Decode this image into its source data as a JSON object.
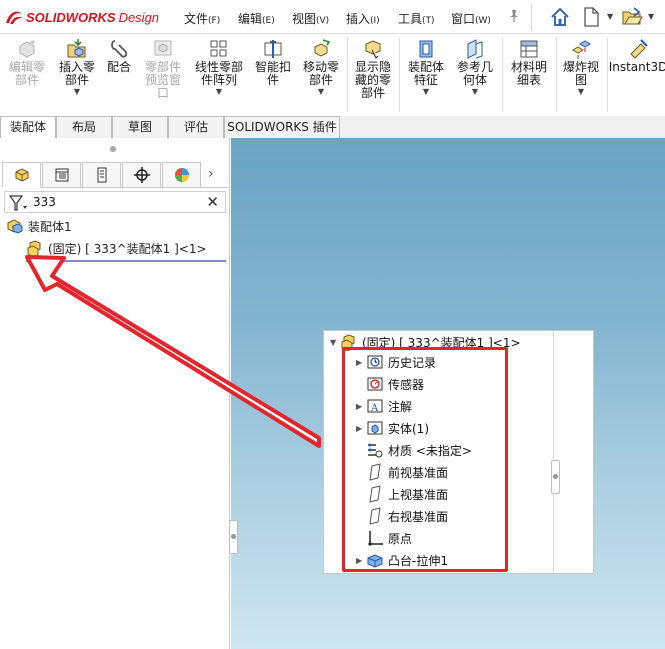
{
  "app": {
    "brand": "SOLIDWORKS",
    "brand_suffix": "Design",
    "brand_color": "#d0161f"
  },
  "menu": [
    {
      "label": "文件",
      "key": "(F)"
    },
    {
      "label": "编辑",
      "key": "(E)"
    },
    {
      "label": "视图",
      "key": "(V)"
    },
    {
      "label": "插入",
      "key": "(I)"
    },
    {
      "label": "工具",
      "key": "(T)"
    },
    {
      "label": "窗口",
      "key": "(W)"
    }
  ],
  "toolbar_icons": [
    "pin-icon",
    "home-icon",
    "new-document-icon",
    "open-folder-icon"
  ],
  "ribbon": [
    {
      "label": "编辑零\n部件",
      "icon": "edit-component-icon",
      "enabled": false,
      "dropdown": false
    },
    {
      "label": "插入零\n部件",
      "icon": "insert-component-icon",
      "enabled": true,
      "dropdown": true
    },
    {
      "label": "配合",
      "icon": "mate-icon",
      "enabled": true,
      "dropdown": false
    },
    {
      "label": "零部件\n预览窗\n口",
      "icon": "component-preview-icon",
      "enabled": false,
      "dropdown": false
    },
    {
      "label": "线性零部\n件阵列",
      "icon": "linear-pattern-icon",
      "enabled": true,
      "dropdown": true
    },
    {
      "label": "智能扣\n件",
      "icon": "smart-fastener-icon",
      "enabled": true,
      "dropdown": false
    },
    {
      "label": "移动零\n部件",
      "icon": "move-component-icon",
      "enabled": true,
      "dropdown": true
    },
    {
      "label": "显示隐\n藏的零\n部件",
      "icon": "show-hidden-icon",
      "enabled": true,
      "dropdown": false
    },
    {
      "label": "装配体\n特征",
      "icon": "assembly-feature-icon",
      "enabled": true,
      "dropdown": true
    },
    {
      "label": "参考几\n何体",
      "icon": "reference-geometry-icon",
      "enabled": true,
      "dropdown": true
    },
    {
      "label": "材料明\n细表",
      "icon": "bom-icon",
      "enabled": true,
      "dropdown": false
    },
    {
      "label": "爆炸视\n图",
      "icon": "exploded-view-icon",
      "enabled": true,
      "dropdown": true
    },
    {
      "label": "Instant3D",
      "icon": "instant3d-icon",
      "enabled": true,
      "dropdown": false
    }
  ],
  "command_tabs": [
    {
      "label": "装配体",
      "active": true
    },
    {
      "label": "布局",
      "active": false
    },
    {
      "label": "草图",
      "active": false
    },
    {
      "label": "评估",
      "active": false
    },
    {
      "label": "SOLIDWORKS 插件",
      "active": false
    }
  ],
  "panel": {
    "tabs": [
      "feature-manager-icon",
      "property-manager-icon",
      "configuration-manager-icon",
      "dimxpert-icon",
      "display-manager-icon"
    ],
    "filter_value": "333",
    "tree": {
      "root": "装配体1",
      "child": "(固定) [ 333^装配体1 ]<1>"
    }
  },
  "popup": {
    "title": "(固定) [ 333^装配体1 ]<1>",
    "items": [
      {
        "label": "历史记录",
        "icon": "history-folder-icon",
        "expandable": true
      },
      {
        "label": "传感器",
        "icon": "sensor-icon",
        "expandable": false
      },
      {
        "label": "注解",
        "icon": "annotation-icon",
        "expandable": true
      },
      {
        "label": "实体(1)",
        "icon": "solid-bodies-icon",
        "expandable": true
      },
      {
        "label": "材质 <未指定>",
        "icon": "material-icon",
        "expandable": false
      },
      {
        "label": "前视基准面",
        "icon": "plane-icon",
        "expandable": false
      },
      {
        "label": "上视基准面",
        "icon": "plane-icon",
        "expandable": false
      },
      {
        "label": "右视基准面",
        "icon": "plane-icon",
        "expandable": false
      },
      {
        "label": "原点",
        "icon": "origin-icon",
        "expandable": false
      },
      {
        "label": "凸台-拉伸1",
        "icon": "boss-extrude-icon",
        "expandable": true
      }
    ]
  },
  "colors": {
    "annotation_red": "#e3262d",
    "viewport_top": "#6ba4c4",
    "viewport_bottom": "#cfe6f0"
  }
}
